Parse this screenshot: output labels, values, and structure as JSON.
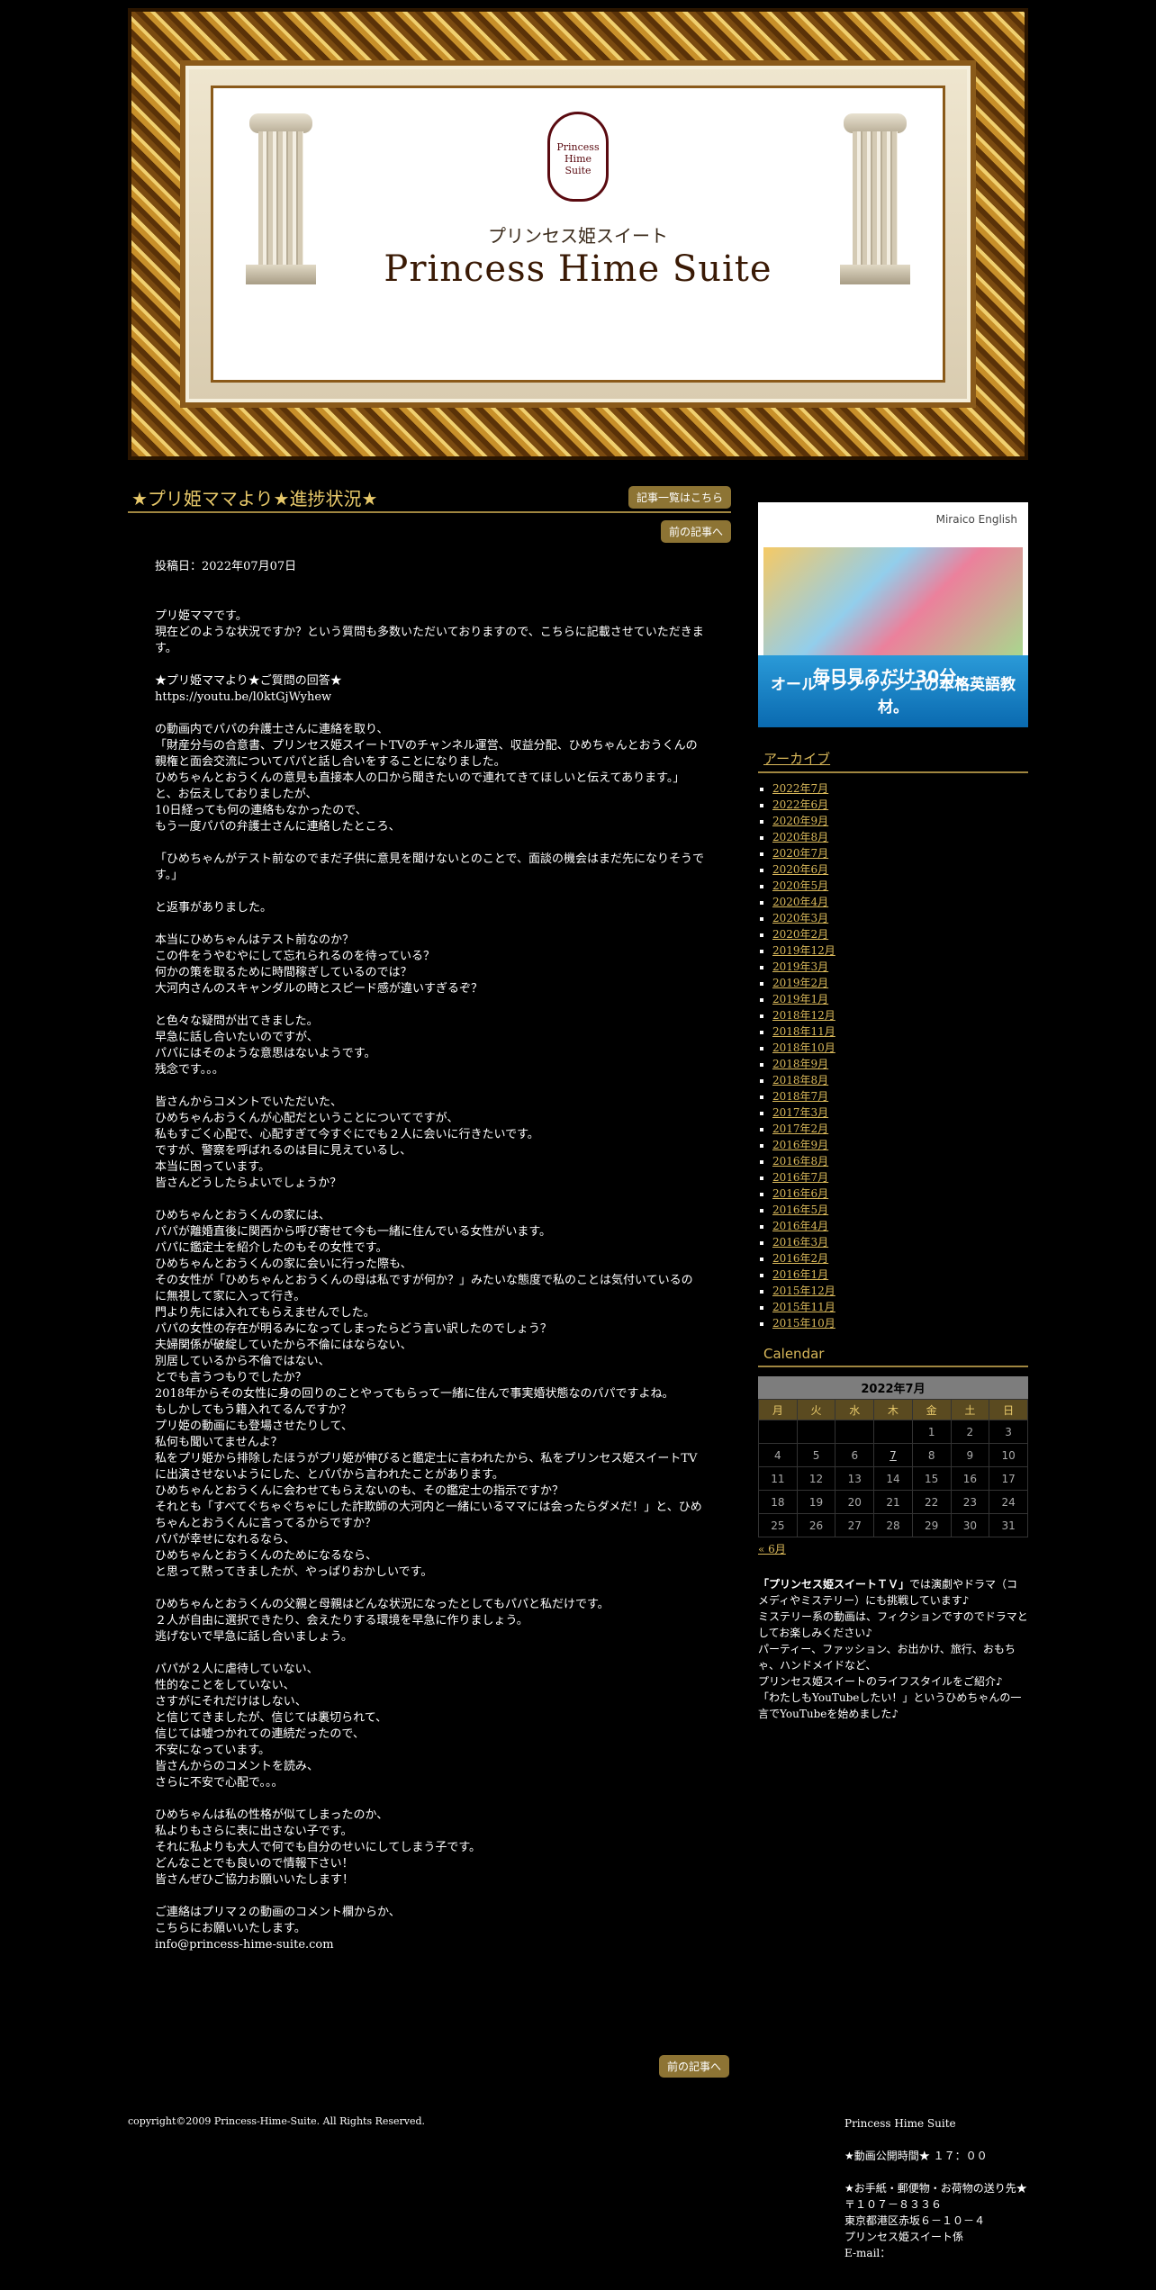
{
  "header": {
    "crest_text": "Princess Hime Suite",
    "logo_jp": "プリンセス姫スイート",
    "logo_en": "Princess Hime Suite"
  },
  "post": {
    "title": "★プリ姫ママより★進捗状況★",
    "list_button": "記事一覧はこちら",
    "prev_button": "前の記事へ",
    "date": "投稿日：2022年07月07日",
    "paragraphs": [
      "プリ姫ママです。\n現在どのような状況ですか？という質問も多数いただいておりますので、こちらに記載させていただきます。",
      "★プリ姫ママより★ご質問の回答★\nhttps://youtu.be/l0ktGjWyhew",
      "の動画内でパパの弁護士さんに連絡を取り、\n「財産分与の合意書、プリンセス姫スイートTVのチャンネル運営、収益分配、ひめちゃんとおうくんの親権と面会交流についてパパと話し合いをすることになりました。\nひめちゃんとおうくんの意見も直接本人の口から聞きたいので連れてきてほしいと伝えてあります。」\nと、お伝えしておりましたが、\n10日経っても何の連絡もなかったので、\nもう一度パパの弁護士さんに連絡したところ、",
      "「ひめちゃんがテスト前なのでまだ子供に意見を聞けないとのことで、面談の機会はまだ先になりそうです。」",
      "と返事がありました。",
      "本当にひめちゃんはテスト前なのか？\nこの件をうやむやにして忘れられるのを待っている？\n何かの策を取るために時間稼ぎしているのでは？\n大河内さんのスキャンダルの時とスピード感が違いすぎるぞ？",
      "と色々な疑問が出てきました。\n早急に話し合いたいのですが、\nパパにはそのような意思はないようです。\n残念です。。。",
      "",
      "皆さんからコメントでいただいた、\nひめちゃんおうくんが心配だということについてですが、\n私もすごく心配で、心配すぎて今すぐにでも２人に会いに行きたいです。\nですが、警察を呼ばれるのは目に見えているし、\n本当に困っています。\n皆さんどうしたらよいでしょうか？",
      "ひめちゃんとおうくんの家には、\nパパが離婚直後に関西から呼び寄せて今も一緒に住んでいる女性がいます。\nパパに鑑定士を紹介したのもその女性です。\nひめちゃんとおうくんの家に会いに行った際も、\nその女性が「ひめちゃんとおうくんの母は私ですが何か？」みたいな態度で私のことは気付いているのに無視して家に入って行き。\n門より先には入れてもらえませんでした。\nパパの女性の存在が明るみになってしまったらどう言い訳したのでしょう？\n夫婦関係が破綻していたから不倫にはならない、\n別居しているから不倫ではない、\nとでも言うつもりでしたか？\n2018年からその女性に身の回りのことやってもらって一緒に住んで事実婚状態なのパパですよね。\nもしかしてもう籍入れてるんですか？\nプリ姫の動画にも登場させたりして、\n私何も聞いてませんよ？\n私をプリ姫から排除したほうがプリ姫が伸びると鑑定士に言われたから、私をプリンセス姫スイートTVに出演させないようにした、とパパから言われたことがあります。\nひめちゃんとおうくんに会わせてもらえないのも、その鑑定士の指示ですか？\nそれとも「すべてぐちゃぐちゃにした詐欺師の大河内と一緒にいるママには会ったらダメだ！」と、ひめちゃんとおうくんに言ってるからですか？\nパパが幸せになれるなら、\nひめちゃんとおうくんのためになるなら、\nと思って黙ってきましたが、やっぱりおかしいです。",
      "ひめちゃんとおうくんの父親と母親はどんな状況になったとしてもパパと私だけです。\n２人が自由に選択できたり、会えたりする環境を早急に作りましょう。\n逃げないで早急に話し合いましょう。",
      "",
      "パパが２人に虐待していない、\n性的なことをしていない、\nさすがにそれだけはしない、\nと信じてきましたが、信じては裏切られて、\n信じては嘘つかれての連続だったので、\n不安になっています。\n皆さんからのコメントを読み、\nさらに不安で心配で。。。",
      "ひめちゃんは私の性格が似てしまったのか、\n私よりもさらに表に出さない子です。\nそれに私よりも大人で何でも自分のせいにしてしまう子です。\nどんなことでも良いので情報下さい！\n皆さんぜひご協力お願いいたします！",
      "",
      "ご連絡はプリマ２の動画のコメント欄からか、\nこちらにお願いいたします。\ninfo@princess-hime-suite.com"
    ]
  },
  "sidebar": {
    "ad": {
      "brand": "Miraico English",
      "line1": "毎日見るだけ30分。",
      "line2": "オールインクリッシュの本格英語教材。"
    },
    "archive_heading": "アーカイブ",
    "archive": [
      "2022年7月",
      "2022年6月",
      "2020年9月",
      "2020年8月",
      "2020年7月",
      "2020年6月",
      "2020年5月",
      "2020年4月",
      "2020年3月",
      "2020年2月",
      "2019年12月",
      "2019年3月",
      "2019年2月",
      "2019年1月",
      "2018年12月",
      "2018年11月",
      "2018年10月",
      "2018年9月",
      "2018年8月",
      "2018年7月",
      "2017年3月",
      "2017年2月",
      "2016年9月",
      "2016年8月",
      "2016年7月",
      "2016年6月",
      "2016年5月",
      "2016年4月",
      "2016年3月",
      "2016年2月",
      "2016年1月",
      "2015年12月",
      "2015年11月",
      "2015年10月"
    ],
    "calendar_heading": "Calendar",
    "calendar": {
      "caption": "2022年7月",
      "weekdays": [
        "月",
        "火",
        "水",
        "木",
        "金",
        "土",
        "日"
      ],
      "weeks": [
        [
          "",
          "",
          "",
          "",
          "1",
          "2",
          "3"
        ],
        [
          "4",
          "5",
          "6",
          "7",
          "8",
          "9",
          "10"
        ],
        [
          "11",
          "12",
          "13",
          "14",
          "15",
          "16",
          "17"
        ],
        [
          "18",
          "19",
          "20",
          "21",
          "22",
          "23",
          "24"
        ],
        [
          "25",
          "26",
          "27",
          "28",
          "29",
          "30",
          "31"
        ]
      ],
      "linked_day": "7",
      "prev_link": "« 6月"
    },
    "about": "「プリンセス姫スイートＴＶ」では演劇やドラマ（コメディやミステリー）にも挑戦しています♪\nミステリー系の動画は、フィクションですのでドラマとしてお楽しみください♪\nパーティー、ファッション、お出かけ、旅行、おもちゃ、ハンドメイドなど、\nプリンセス姫スイートのライフスタイルをご紹介♪\n「わたしもYouTubeしたい！」というひめちゃんの一言でYouTubeを始めました♪",
    "about_bold": "「プリンセス姫スイートＴＶ」"
  },
  "footer": {
    "copyright": "copyright©2009 Princess-Hime-Suite. All Rights Reserved.",
    "info": "Princess Hime Suite\n\n★動画公開時間★ １７：００\n\n★お手紙・郵便物・お荷物の送り先★\n〒１０７－８３３６\n東京都港区赤坂６－１０－４\nプリンセス姫スイート係\nE-mail："
  }
}
